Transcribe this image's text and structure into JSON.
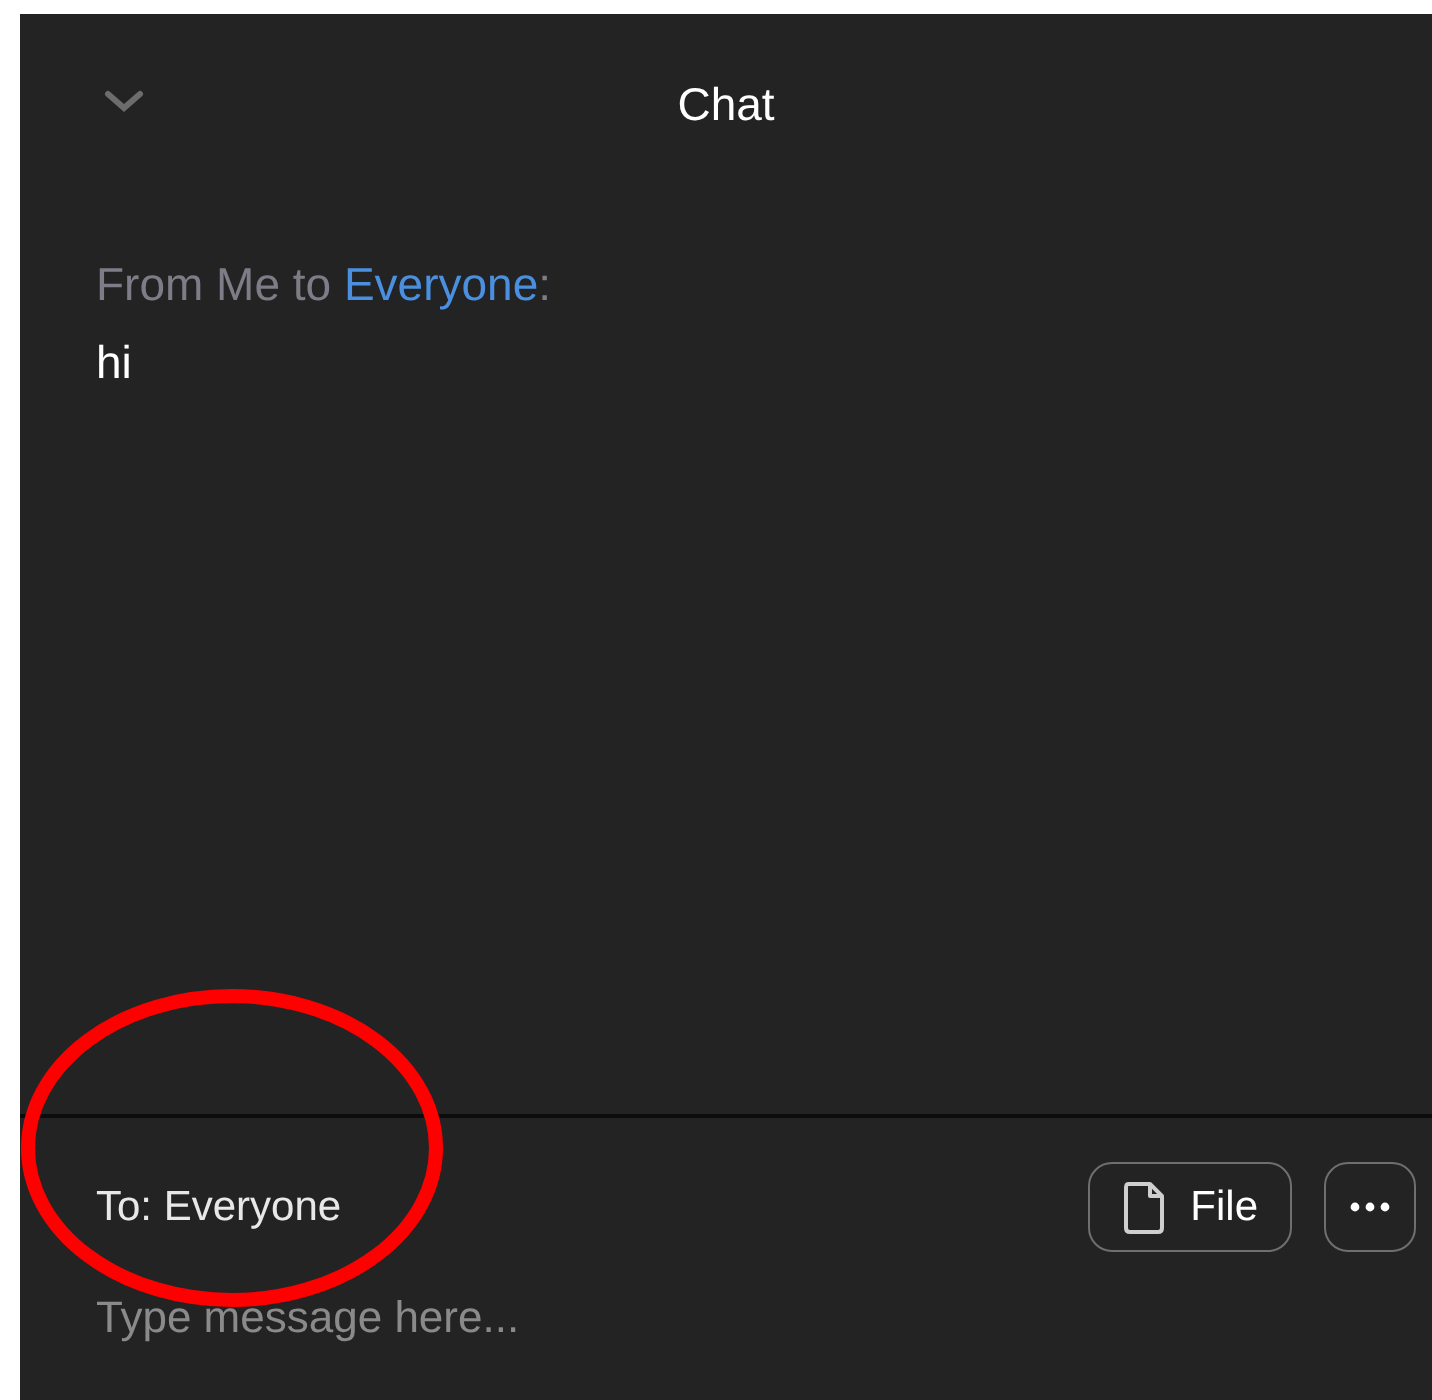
{
  "header": {
    "title": "Chat"
  },
  "messages": [
    {
      "from_text": "From Me to",
      "recipient": "Everyone",
      "suffix": ":",
      "text": "hi"
    }
  ],
  "composer": {
    "to_label": "To: Everyone",
    "buttons": [
      {
        "kind": "file",
        "label": "File"
      },
      {
        "kind": "more"
      }
    ],
    "placeholder": "Type message here..."
  },
  "annotation": {
    "kind": "circle"
  }
}
